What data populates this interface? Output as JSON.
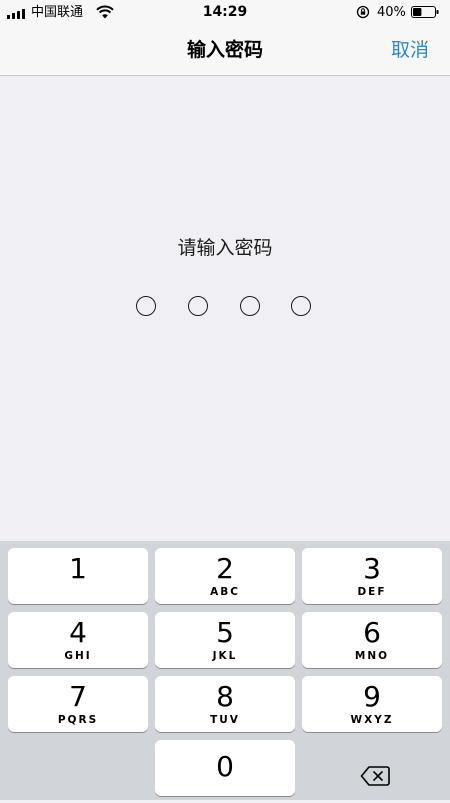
{
  "status_bar": {
    "carrier": "中国联通",
    "time": "14:29",
    "battery_percent": "40%",
    "battery_level": 0.4
  },
  "nav": {
    "title": "输入密码",
    "cancel_label": "取消",
    "accent_color": "#2d89c7"
  },
  "prompt": {
    "text": "请输入密码",
    "digits_entered": 0,
    "digits_total": 4
  },
  "keypad": {
    "keys": [
      {
        "num": "1",
        "letters": ""
      },
      {
        "num": "2",
        "letters": "ABC"
      },
      {
        "num": "3",
        "letters": "DEF"
      },
      {
        "num": "4",
        "letters": "GHI"
      },
      {
        "num": "5",
        "letters": "JKL"
      },
      {
        "num": "6",
        "letters": "MNO"
      },
      {
        "num": "7",
        "letters": "PQRS"
      },
      {
        "num": "8",
        "letters": "TUV"
      },
      {
        "num": "9",
        "letters": "WXYZ"
      },
      {
        "num": "0",
        "letters": ""
      }
    ],
    "delete_icon": "backspace-icon"
  }
}
